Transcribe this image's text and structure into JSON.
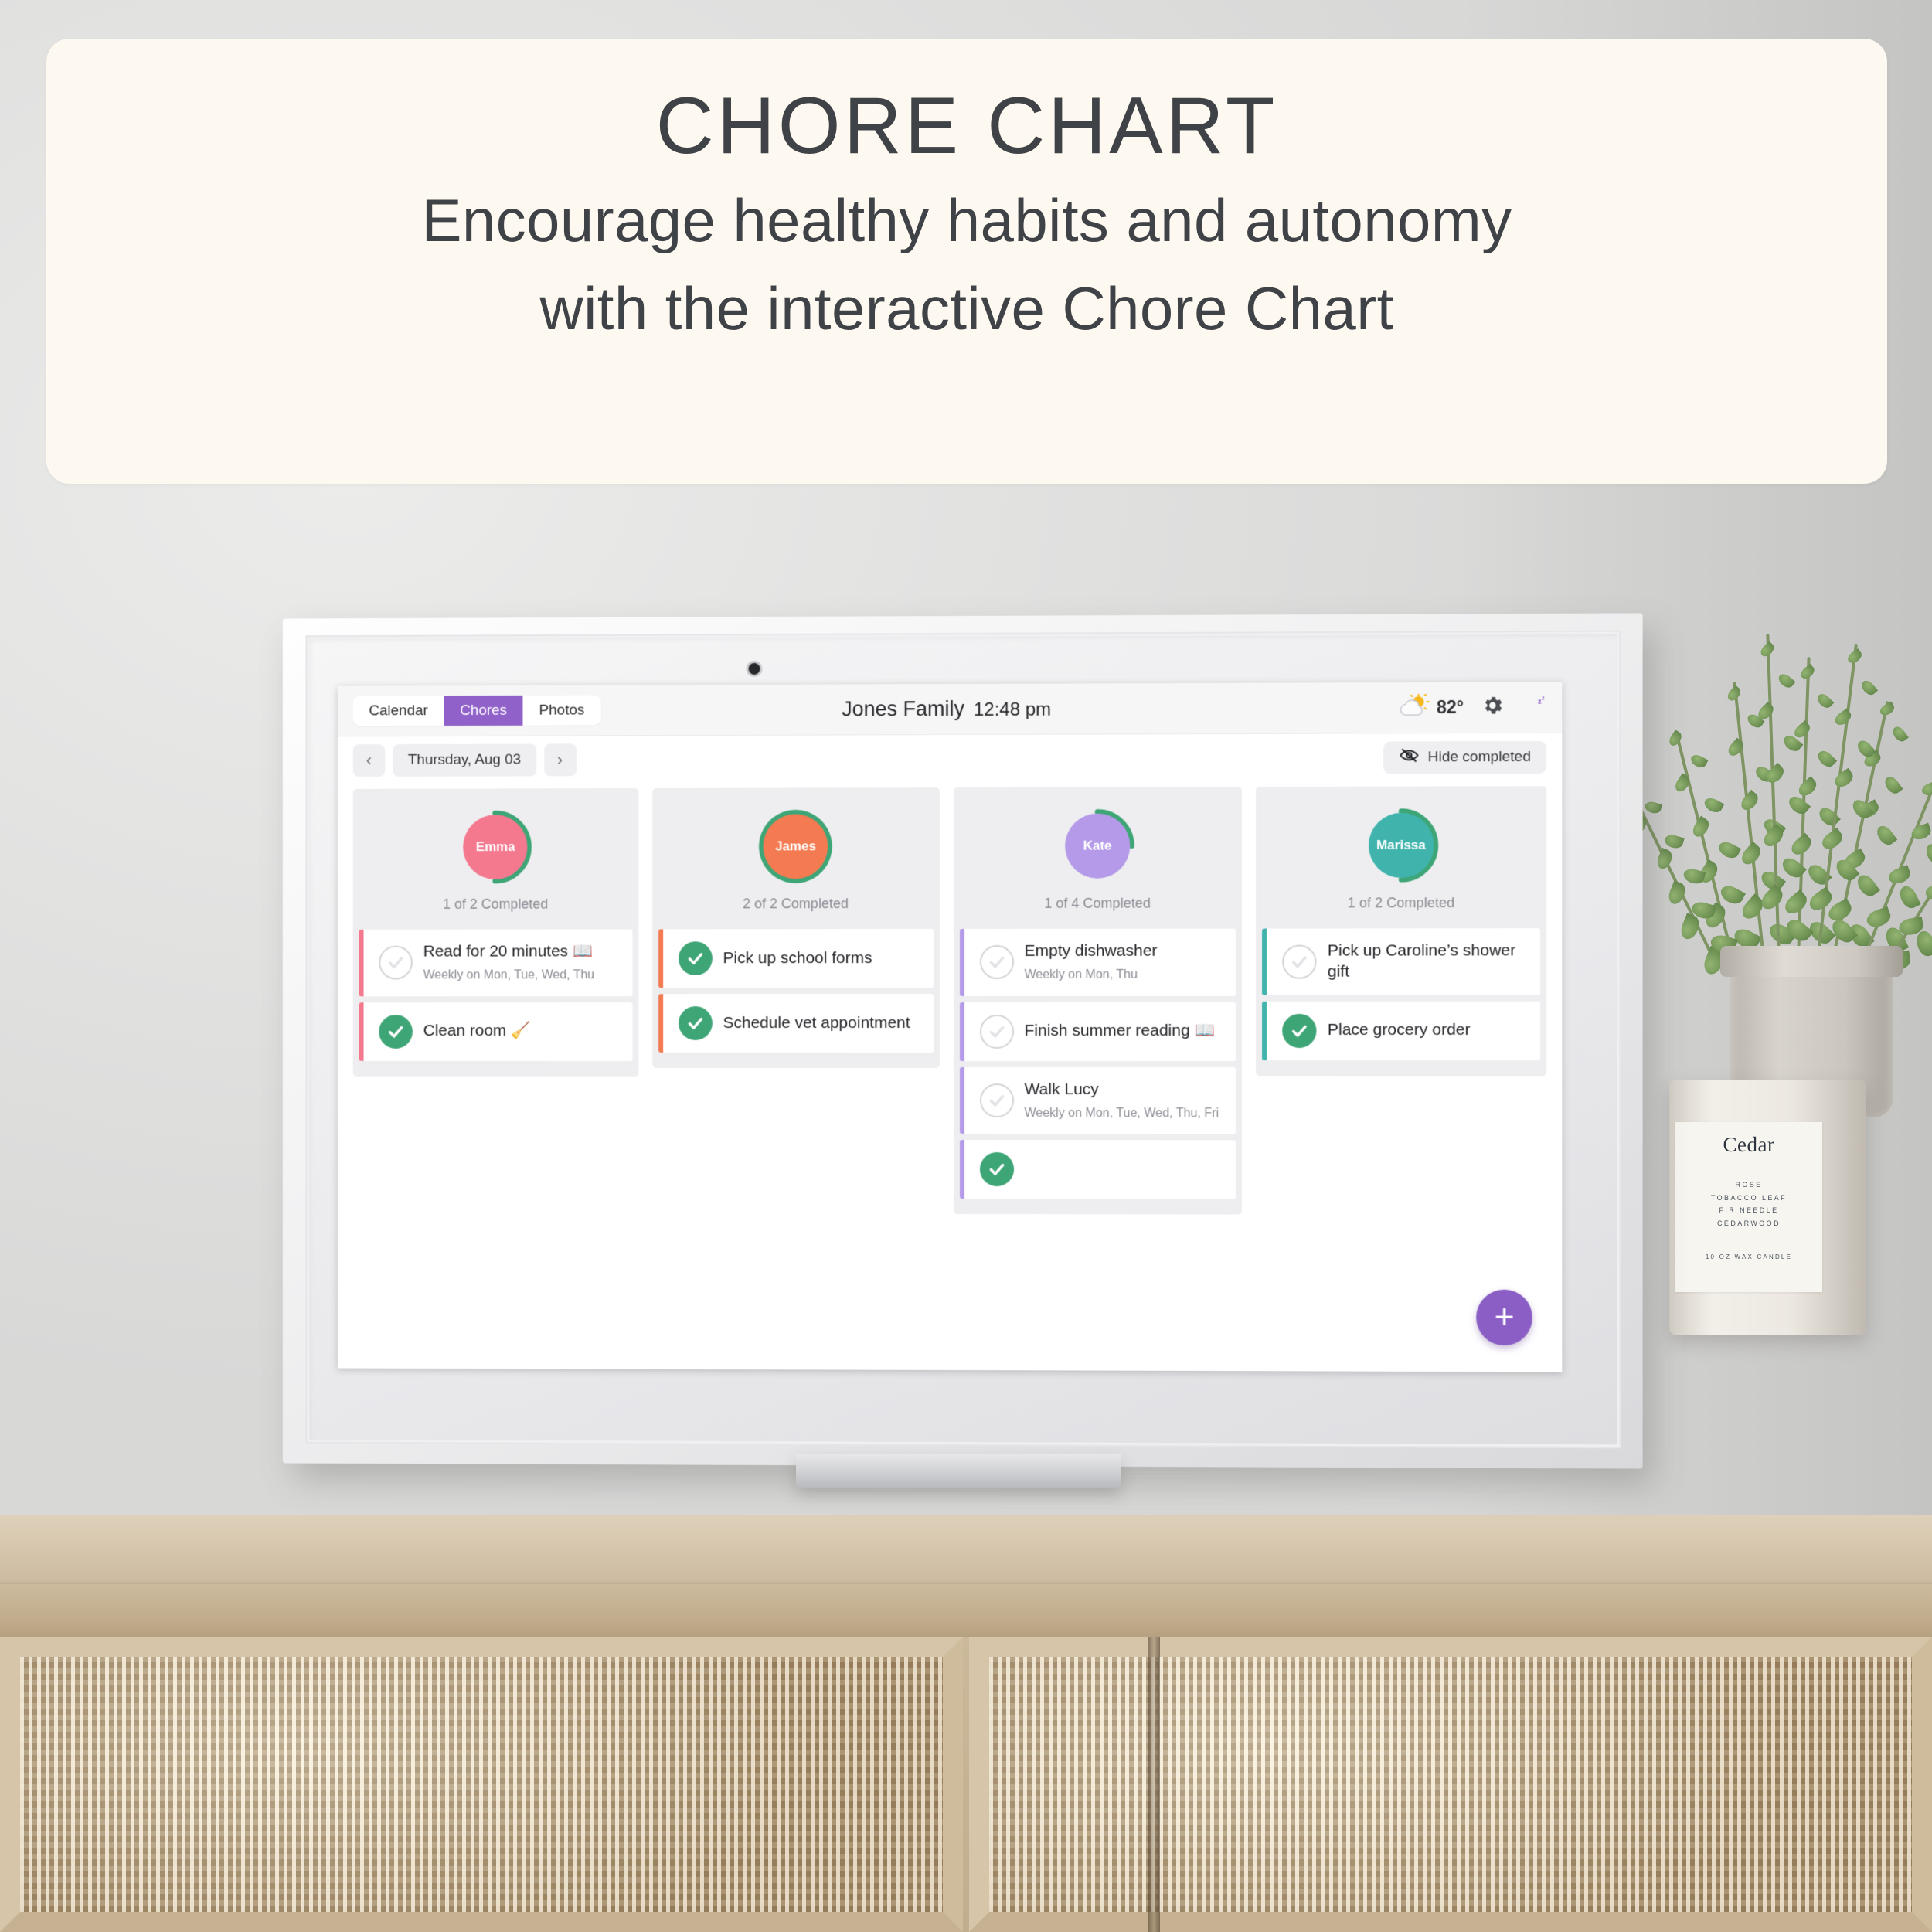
{
  "banner": {
    "title": "CHORE CHART",
    "subtitle_line1": "Encourage healthy habits and autonomy",
    "subtitle_line2": "with the interactive Chore Chart",
    "background": "#fdf9f0",
    "text_color": "#3f4246"
  },
  "device": {
    "type": "smart-display",
    "frame_color": "#f2f2f3"
  },
  "app": {
    "topbar": {
      "tabs": [
        {
          "label": "Calendar",
          "active": false
        },
        {
          "label": "Chores",
          "active": true
        },
        {
          "label": "Photos",
          "active": false
        }
      ],
      "active_tab_color": "#9061c9",
      "family_name": "Jones Family",
      "time": "12:48 pm",
      "weather": {
        "icon": "sun-behind-cloud-icon",
        "temperature": "82°"
      },
      "settings_icon": "gear-icon",
      "sleep_icon": "moon-zzz-icon"
    },
    "toolbar": {
      "prev_label": "‹",
      "next_label": "›",
      "date": "Thursday, Aug 03",
      "hide_completed_label": "Hide completed",
      "hide_completed_icon": "eye-slash-icon"
    },
    "add_button_label": "+",
    "add_button_color": "#8b5ec6",
    "done_color": "#3ea576",
    "people": [
      {
        "name": "Emma",
        "avatar_color": "#f4798f",
        "accent_color": "#f4798f",
        "progress_label": "1 of 2 Completed",
        "completed": 1,
        "total": 2,
        "chores": [
          {
            "title": "Read for 20 minutes 📖",
            "sub": "Weekly on Mon, Tue, Wed, Thu",
            "done": false
          },
          {
            "title": "Clean room 🧹",
            "sub": "",
            "done": true
          }
        ]
      },
      {
        "name": "James",
        "avatar_color": "#f47b51",
        "accent_color": "#f47b51",
        "progress_label": "2 of 2 Completed",
        "completed": 2,
        "total": 2,
        "chores": [
          {
            "title": "Pick up school forms",
            "sub": "",
            "done": true
          },
          {
            "title": "Schedule vet appointment",
            "sub": "",
            "done": true
          }
        ]
      },
      {
        "name": "Kate",
        "avatar_color": "#b49ae8",
        "accent_color": "#b49ae8",
        "progress_label": "1 of 4 Completed",
        "completed": 1,
        "total": 4,
        "chores": [
          {
            "title": "Empty dishwasher",
            "sub": "Weekly on Mon, Thu",
            "done": false
          },
          {
            "title": "Finish summer reading 📖",
            "sub": "",
            "done": false
          },
          {
            "title": "Walk Lucy",
            "sub": "Weekly on Mon, Tue, Wed, Thu, Fri",
            "done": false
          },
          {
            "title": "",
            "sub": "",
            "done": true
          }
        ]
      },
      {
        "name": "Marissa",
        "avatar_color": "#3fb3ac",
        "accent_color": "#3fb3ac",
        "progress_label": "1 of 2 Completed",
        "completed": 1,
        "total": 2,
        "chores": [
          {
            "title": "Pick up Caroline’s shower gift",
            "sub": "",
            "done": false
          },
          {
            "title": "Place grocery order",
            "sub": "",
            "done": true
          }
        ]
      }
    ]
  },
  "scene": {
    "candle": {
      "brand": "Cedar",
      "notes": [
        "ROSE",
        "TOBACCO LEAF",
        "FIR NEEDLE",
        "CEDARWOOD"
      ],
      "size": "10 OZ WAX CANDLE"
    }
  }
}
